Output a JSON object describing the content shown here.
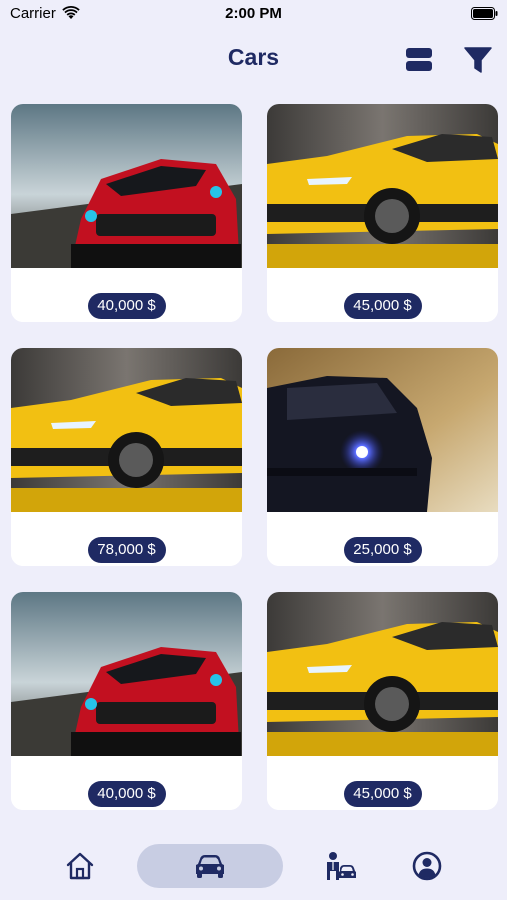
{
  "status_bar": {
    "carrier": "Carrier",
    "time": "2:00 PM"
  },
  "header": {
    "title": "Cars",
    "layout_icon": "view-rows-icon",
    "filter_icon": "filter-icon"
  },
  "cars": [
    {
      "price": "40,000 $",
      "image": "red-sports-car"
    },
    {
      "price": "45,000 $",
      "image": "yellow-sports-car"
    },
    {
      "price": "78,000 $",
      "image": "yellow-sports-car"
    },
    {
      "price": "25,000 $",
      "image": "dark-blue-car-headlight"
    },
    {
      "price": "40,000 $",
      "image": "red-sports-car"
    },
    {
      "price": "45,000 $",
      "image": "yellow-sports-car"
    }
  ],
  "tabs": [
    {
      "icon": "home-icon",
      "active": false
    },
    {
      "icon": "car-icon",
      "active": true
    },
    {
      "icon": "dealer-icon",
      "active": false
    },
    {
      "icon": "profile-icon",
      "active": false
    }
  ],
  "colors": {
    "accent": "#1f2a63",
    "background": "#eeeefa",
    "active_tab": "#c8cde3",
    "card": "#ffffff"
  }
}
